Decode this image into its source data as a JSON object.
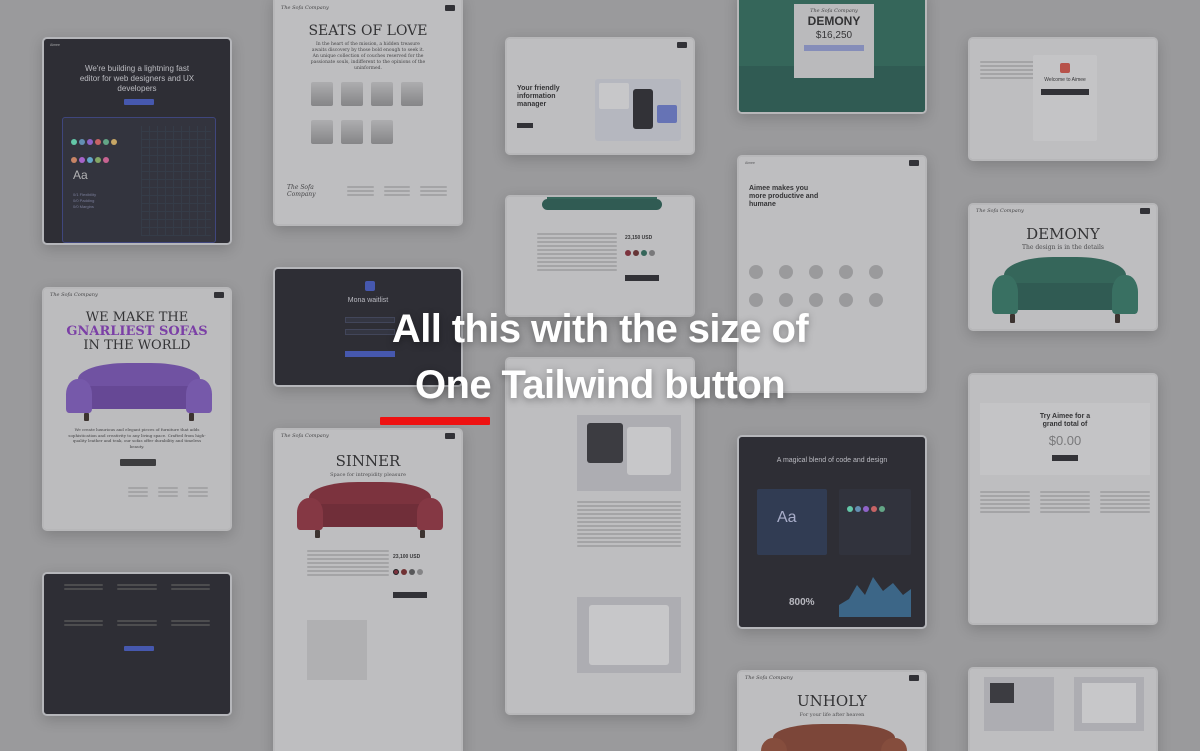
{
  "headline": {
    "line1": "All this with the size of",
    "line2": "One Tailwind button",
    "accent_color": "#ee1111"
  },
  "cards": {
    "editor": {
      "brand": "Aimee",
      "title": "We're building a lightning fast editor for web designers and UX developers",
      "sample_glyph": "Aa",
      "list": [
        "0/1 Flexibility",
        "0/0 Padding",
        "0/0 Margins"
      ]
    },
    "seats": {
      "title": "SEATS OF LOVE",
      "body": "In the heart of the mission, a hidden treasure awaits discovery by those bold enough to seek it. An unique collection of couches reserved for the passionate souls, indifferent to the opinions of the uninformed.",
      "logo": "The Sofa Company"
    },
    "manager": {
      "title": "Your friendly information manager"
    },
    "demony_top": {
      "logo": "The Sofa Company",
      "title": "DEMONY",
      "price": "$16,250"
    },
    "aimee_modal": {
      "title": "Welcome to Aimee"
    },
    "gnarliest": {
      "logo": "The Sofa Company",
      "line1": "WE MAKE THE",
      "line2": "GNARLIEST SOFAS",
      "line3": "IN THE WORLD",
      "body": "We create luxurious and elegant pieces of furniture that adds sophistication and creativity to any living space. Crafted from high-quality leather and teak, our sofas offer durability and timeless beauty."
    },
    "mona": {
      "title": "Mona waitlist"
    },
    "aimee_productive": {
      "brand": "Aimee",
      "title": "Aimee makes you more productive and humane"
    },
    "demony_right": {
      "logo": "The Sofa Company",
      "title": "DEMONY",
      "subtitle": "The design is in the details"
    },
    "product_page": {
      "price": "23,150 USD"
    },
    "sinner": {
      "logo": "The Sofa Company",
      "title": "SINNER",
      "subtitle": "Space for intrepidity pleasure",
      "price": "23,100 USD"
    },
    "pricing": {
      "title": "Try Aimee for a grand total of",
      "price": "$0.00"
    },
    "code_design": {
      "title": "A magical blend of code and design",
      "glyph": "Aa",
      "stat": "800%"
    },
    "unholy": {
      "logo": "The Sofa Company",
      "title": "UNHOLY",
      "subtitle": "For your life after heaven"
    }
  },
  "colors": {
    "background": "#9a9a9c",
    "purple_sofa": "#7a4cc4",
    "green_sofa": "#1f6b55",
    "red_sofa": "#8c1c2a",
    "brown_sofa": "#8c3a22",
    "purple_text": "#8a2fc9",
    "blue_button": "#3a55d6"
  }
}
